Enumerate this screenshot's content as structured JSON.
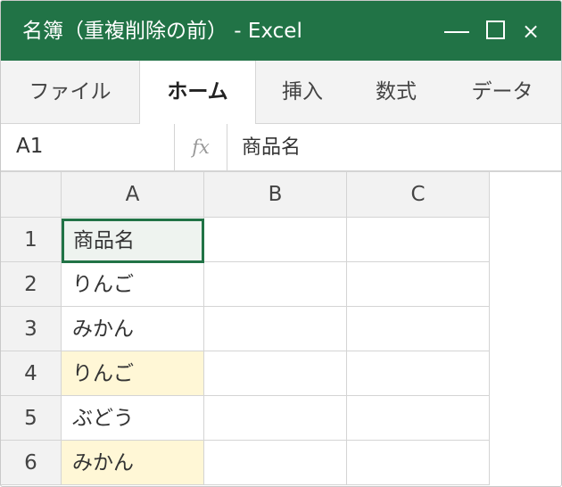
{
  "window": {
    "title": "名簿（重複削除の前） - Excel",
    "minimize": "—",
    "close": "×"
  },
  "ribbon": {
    "tabs": [
      {
        "label": "ファイル"
      },
      {
        "label": "ホーム",
        "active": true
      },
      {
        "label": "挿入"
      },
      {
        "label": "数式"
      },
      {
        "label": "データ"
      }
    ]
  },
  "formula_bar": {
    "name_box": "A1",
    "fx_label": "fx",
    "content": "商品名"
  },
  "sheet": {
    "columns": [
      "A",
      "B",
      "C"
    ],
    "rows": [
      {
        "num": "1",
        "A": "商品名",
        "B": "",
        "C": ""
      },
      {
        "num": "2",
        "A": "りんご",
        "B": "",
        "C": ""
      },
      {
        "num": "3",
        "A": "みかん",
        "B": "",
        "C": ""
      },
      {
        "num": "4",
        "A": "りんご",
        "B": "",
        "C": "",
        "duplicate": true
      },
      {
        "num": "5",
        "A": "ぶどう",
        "B": "",
        "C": ""
      },
      {
        "num": "6",
        "A": "みかん",
        "B": "",
        "C": "",
        "duplicate": true
      }
    ],
    "selected_cell": "A1",
    "duplicate_highlight_color": "#fff7d6",
    "accent_color": "#217346"
  }
}
